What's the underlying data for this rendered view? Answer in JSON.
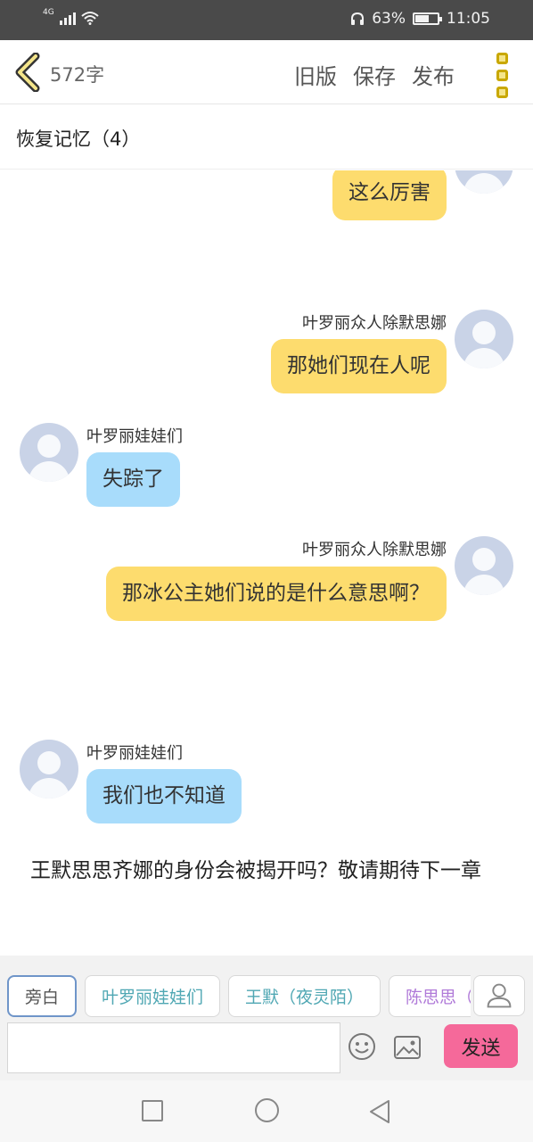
{
  "status_bar": {
    "network": "4G",
    "battery_percent": "63%",
    "battery_level": 0.63,
    "time": "11:05",
    "icons": [
      "signal-icon",
      "wifi-icon",
      "headphone-icon",
      "battery-icon"
    ]
  },
  "header": {
    "back_icon": "chevron-left-icon",
    "word_count": "572字",
    "actions": {
      "old_version": "旧版",
      "save": "保存",
      "publish": "发布"
    },
    "menu_icon": "more-vertical-icon"
  },
  "chapter": {
    "title": "恢复记忆（4）"
  },
  "messages": [
    {
      "side": "right",
      "speaker": "",
      "text": "这么厉害",
      "color": "#fddc6e"
    },
    {
      "side": "right",
      "speaker": "叶罗丽众人除默思娜",
      "text": "那她们现在人呢",
      "color": "#fddc6e"
    },
    {
      "side": "left",
      "speaker": "叶罗丽娃娃们",
      "text": "失踪了",
      "color": "#a8dcfb"
    },
    {
      "side": "right",
      "speaker": "叶罗丽众人除默思娜",
      "text": "那冰公主她们说的是什么意思啊？",
      "color": "#fddc6e"
    },
    {
      "side": "left",
      "speaker": "叶罗丽娃娃们",
      "text": "我们也不知道",
      "color": "#a8dcfb"
    }
  ],
  "narration": "王默思思齐娜的身份会被揭开吗？敬请期待下一章",
  "composer": {
    "roles": [
      "旁白",
      "叶罗丽娃娃们",
      "王默（夜灵陌）",
      "陈思思（"
    ],
    "input_value": "",
    "send_label": "发送",
    "icons": [
      "person-icon",
      "emoji-icon",
      "image-icon"
    ]
  },
  "nav_bar": {
    "icons": [
      "recent-apps-icon",
      "home-icon",
      "back-icon"
    ]
  },
  "colors": {
    "accent_yellow": "#fddc6e",
    "accent_blue": "#a8dcfb",
    "send_pink": "#f5699a",
    "role_teal": "#4fa7b3"
  }
}
